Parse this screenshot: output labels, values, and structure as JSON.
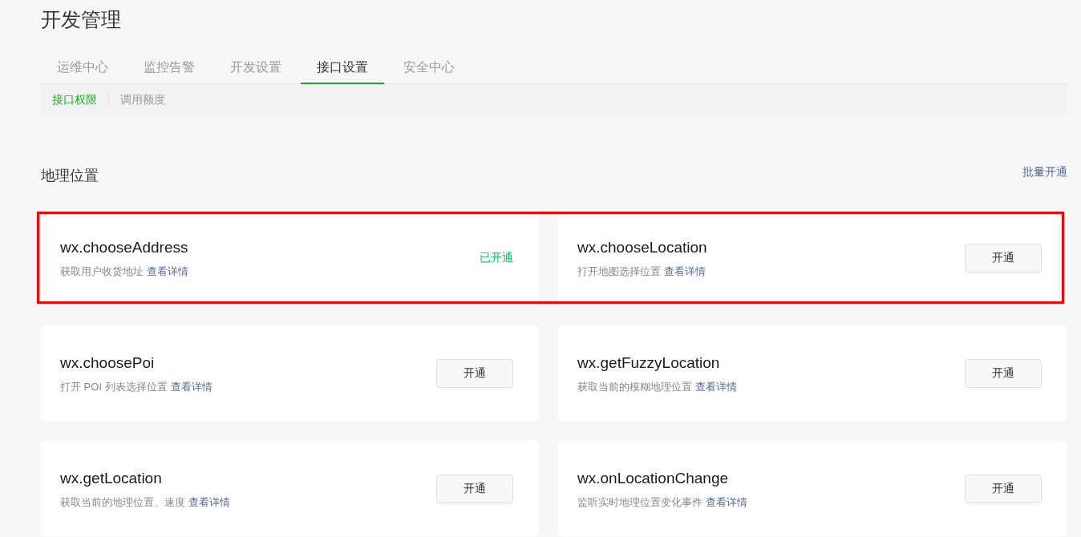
{
  "page_title": "开发管理",
  "tabs": [
    {
      "label": "运维中心",
      "selected": false
    },
    {
      "label": "监控告警",
      "selected": false
    },
    {
      "label": "开发设置",
      "selected": false
    },
    {
      "label": "接口设置",
      "selected": true
    },
    {
      "label": "安全中心",
      "selected": false
    }
  ],
  "subtabs": [
    {
      "label": "接口权限",
      "selected": true
    },
    {
      "label": "调用额度",
      "selected": false
    }
  ],
  "section": {
    "title": "地理位置",
    "action": "批量开通"
  },
  "rows": [
    {
      "highlighted": true,
      "items": [
        {
          "name": "wx.chooseAddress",
          "description": "获取用户收货地址",
          "link": "查看详情",
          "kind": "status",
          "status": "已开通"
        },
        {
          "name": "wx.chooseLocation",
          "description": "打开地图选择位置",
          "link": "查看详情",
          "kind": "button",
          "button": "开通"
        }
      ]
    },
    {
      "highlighted": false,
      "items": [
        {
          "name": "wx.choosePoi",
          "description": "打开 POI 列表选择位置",
          "link": "查看详情",
          "kind": "button",
          "button": "开通"
        },
        {
          "name": "wx.getFuzzyLocation",
          "description": "获取当前的模糊地理位置",
          "link": "查看详情",
          "kind": "button",
          "button": "开通"
        }
      ]
    },
    {
      "highlighted": false,
      "items": [
        {
          "name": "wx.getLocation",
          "description": "获取当前的地理位置、速度",
          "link": "查看详情",
          "kind": "button",
          "button": "开通"
        },
        {
          "name": "wx.onLocationChange",
          "description": "监听实时地理位置变化事件",
          "link": "查看详情",
          "kind": "button",
          "button": "开通"
        }
      ]
    }
  ]
}
